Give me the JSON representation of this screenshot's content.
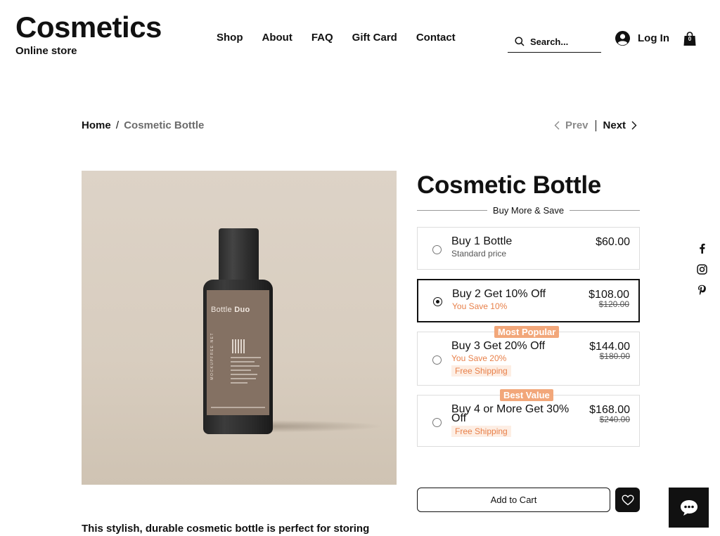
{
  "header": {
    "brand_title": "Cosmetics",
    "brand_subtitle": "Online store",
    "nav": [
      "Shop",
      "About",
      "FAQ",
      "Gift Card",
      "Contact"
    ],
    "search_placeholder": "Search...",
    "login_label": "Log In",
    "cart_count": "0"
  },
  "breadcrumb": {
    "home": "Home",
    "separator": "/",
    "current": "Cosmetic Bottle"
  },
  "pager": {
    "prev": "Prev",
    "next": "Next"
  },
  "product": {
    "image_label": {
      "brand": "Bottle",
      "brand_bold": "Duo",
      "vertical_text": "MOCKUPFREE.NET"
    },
    "title": "Cosmetic Bottle",
    "offers_heading": "Buy More & Save",
    "offers": [
      {
        "name": "Buy 1 Bottle",
        "sub": "Standard price",
        "price": "$60.00",
        "old_price": "",
        "shipping": "",
        "badge": "",
        "selected": false
      },
      {
        "name": "Buy 2 Get 10% Off",
        "sub": "You Save 10%",
        "price": "$108.00",
        "old_price": "$120.00",
        "shipping": "",
        "badge": "",
        "selected": true
      },
      {
        "name": "Buy 3 Get 20% Off",
        "sub": "You Save 20%",
        "price": "$144.00",
        "old_price": "$180.00",
        "shipping": "Free Shipping",
        "badge": "Most Popular",
        "selected": false
      },
      {
        "name_line1": "Buy 4 or More Get 30%",
        "name_line2": "Off",
        "sub": "",
        "price": "$168.00",
        "old_price": "$240.00",
        "shipping": "Free Shipping",
        "badge": "Best Value",
        "selected": false
      }
    ],
    "add_to_cart": "Add to Cart",
    "description_start": "This stylish, durable cosmetic bottle is perfect for storing"
  },
  "colors": {
    "accent_orange": "#e8804a",
    "badge_orange": "#f2a77a",
    "image_bg": "#d8cdbf"
  },
  "icons": [
    "search-icon",
    "user-icon",
    "cart-icon",
    "chevron-left-icon",
    "chevron-right-icon",
    "facebook-icon",
    "instagram-icon",
    "pinterest-icon",
    "heart-icon",
    "chat-icon"
  ]
}
